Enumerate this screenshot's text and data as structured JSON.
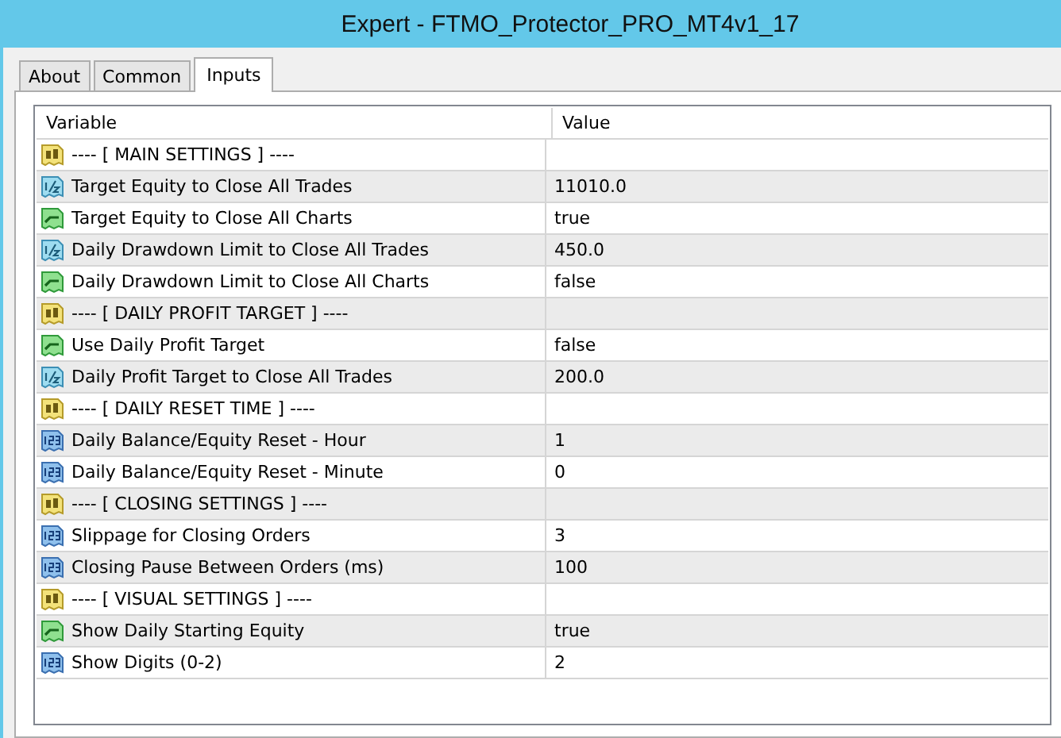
{
  "window": {
    "title": "Expert - FTMO_Protector_PRO_MT4v1_17"
  },
  "tabs": [
    {
      "label": "About",
      "selected": false
    },
    {
      "label": "Common",
      "selected": false
    },
    {
      "label": "Inputs",
      "selected": true
    }
  ],
  "table": {
    "columns": [
      "Variable",
      "Value"
    ],
    "rows": [
      {
        "kind": "string",
        "variable": "---- [ MAIN SETTINGS ] ----"
      },
      {
        "kind": "double",
        "variable": "Target Equity to Close All Trades",
        "value": "11010.0"
      },
      {
        "kind": "bool",
        "variable": "Target Equity to Close All Charts",
        "value": "true"
      },
      {
        "kind": "double",
        "variable": "Daily Drawdown Limit to Close All Trades",
        "value": "450.0"
      },
      {
        "kind": "bool",
        "variable": "Daily Drawdown Limit to Close All Charts",
        "value": "false"
      },
      {
        "kind": "string",
        "variable": "---- [ DAILY PROFIT TARGET ] ----"
      },
      {
        "kind": "bool",
        "variable": "Use Daily Profit Target",
        "value": "false"
      },
      {
        "kind": "double",
        "variable": "Daily Profit Target to Close All Trades",
        "value": "200.0"
      },
      {
        "kind": "string",
        "variable": "---- [ DAILY RESET TIME  ] ----"
      },
      {
        "kind": "int",
        "variable": "Daily Balance/Equity Reset - Hour",
        "value": "1"
      },
      {
        "kind": "int",
        "variable": "Daily Balance/Equity Reset - Minute",
        "value": "0"
      },
      {
        "kind": "string",
        "variable": "---- [ CLOSING SETTINGS ] ----"
      },
      {
        "kind": "int",
        "variable": "Slippage for Closing Orders",
        "value": "3"
      },
      {
        "kind": "int",
        "variable": "Closing Pause Between Orders (ms)",
        "value": "100"
      },
      {
        "kind": "string",
        "variable": "---- [ VISUAL SETTINGS ] ----"
      },
      {
        "kind": "bool",
        "variable": "Show Daily Starting Equity",
        "value": "true"
      },
      {
        "kind": "int",
        "variable": "Show Digits (0-2)",
        "value": "2"
      }
    ]
  }
}
